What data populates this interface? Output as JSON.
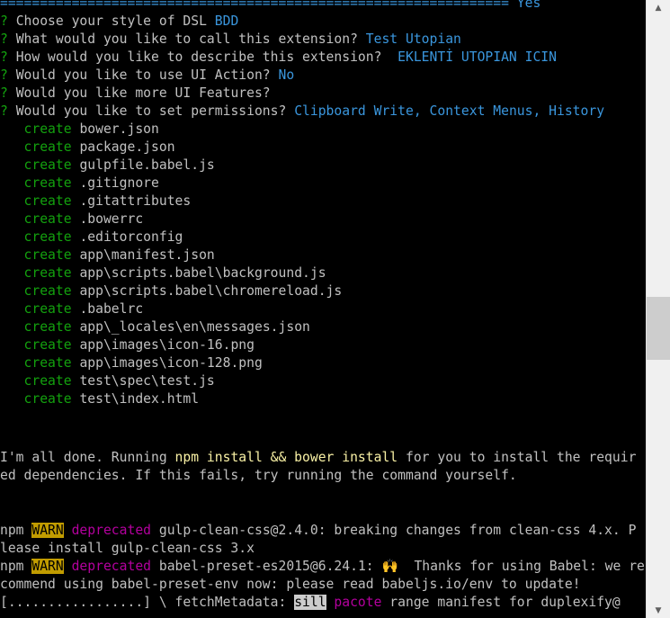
{
  "terminal": {
    "separator": "================================================================ Yes",
    "prompts": [
      {
        "mark": "?",
        "question": "Choose your style of DSL",
        "answer": "BDD"
      },
      {
        "mark": "?",
        "question": "What would you like to call this extension?",
        "answer": "Test Utopian"
      },
      {
        "mark": "?",
        "question": "How would you like to describe this extension?",
        "answer": " EKLENTİ UTOPIAN ICIN"
      },
      {
        "mark": "?",
        "question": "Would you like to use UI Action?",
        "answer": "No"
      },
      {
        "mark": "?",
        "question": "Would you like more UI Features?",
        "answer": ""
      },
      {
        "mark": "?",
        "question": "Would you like to set permissions?",
        "answer": "Clipboard Write, Context Menus, History"
      }
    ],
    "create_label": "create",
    "created_files": [
      "bower.json",
      "package.json",
      "gulpfile.babel.js",
      ".gitignore",
      ".gitattributes",
      ".bowerrc",
      ".editorconfig",
      "app\\manifest.json",
      "app\\scripts.babel\\background.js",
      "app\\scripts.babel\\chromereload.js",
      ".babelrc",
      "app\\_locales\\en\\messages.json",
      "app\\images\\icon-16.png",
      "app\\images\\icon-128.png",
      "test\\spec\\test.js",
      "test\\index.html"
    ],
    "done_msg": {
      "prefix": "I'm all done. Running ",
      "cmd": "npm install && bower install",
      "suffix": " for you to install the requir",
      "line2": "ed dependencies. If this fails, try running the command yourself."
    },
    "npm_lines": [
      {
        "prefix": "npm ",
        "badge": "WARN",
        "level": "deprecated",
        "text": " gulp-clean-css@2.4.0: breaking changes from clean-css 4.x. P",
        "cont": "lease install gulp-clean-css 3.x"
      },
      {
        "prefix": "npm ",
        "badge": "WARN",
        "level": "deprecated",
        "text": " babel-preset-es2015@6.24.1: 🙌  Thanks for using Babel: we re",
        "cont": "commend using babel-preset-env now: please read babeljs.io/env to update!"
      }
    ],
    "progress": {
      "bar": "[.................] \\ fetchMetadata: ",
      "badge": "sill",
      "module": "pacote",
      "text": " range manifest for duplexify@"
    }
  },
  "scrollbar": {
    "up_arrow": "▲",
    "down_arrow": "▼"
  }
}
